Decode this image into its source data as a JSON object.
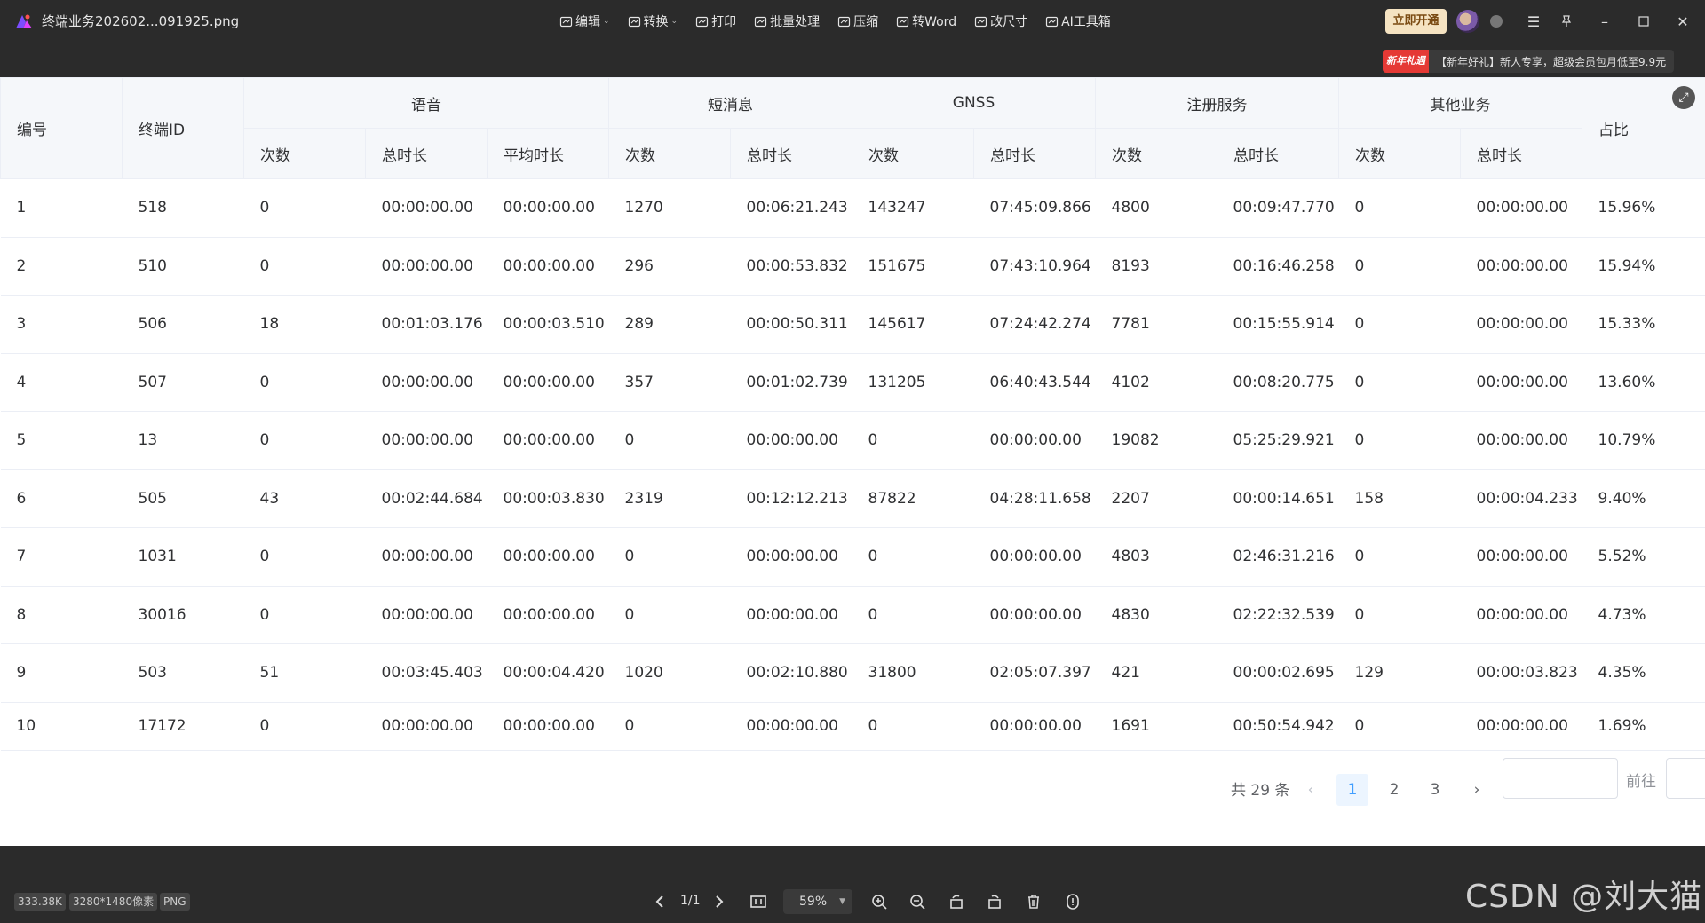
{
  "titlebar": {
    "file_name": "终端业务202602...091925.png",
    "tools": [
      {
        "label": "编辑",
        "icon": "edit-icon",
        "dropdown": true
      },
      {
        "label": "转换",
        "icon": "convert-icon",
        "dropdown": true
      },
      {
        "label": "打印",
        "icon": "print-icon",
        "dropdown": false
      },
      {
        "label": "批量处理",
        "icon": "batch-icon",
        "dropdown": false
      },
      {
        "label": "压缩",
        "icon": "compress-icon",
        "dropdown": false
      },
      {
        "label": "转Word",
        "icon": "word-icon",
        "dropdown": false
      },
      {
        "label": "改尺寸",
        "icon": "resize-icon",
        "dropdown": false
      },
      {
        "label": "AI工具箱",
        "icon": "ai-toolbox-icon",
        "dropdown": false
      }
    ],
    "vip_label": "立即开通",
    "promo_tag": "新年礼遇",
    "promo_text": "【新年好礼】新人专享，超级会员包月低至9.9元"
  },
  "table": {
    "header_groups": {
      "id": "编号",
      "terminal": "终端ID",
      "voice": "语音",
      "sms": "短消息",
      "gnss": "GNSS",
      "register": "注册服务",
      "other": "其他业务",
      "ratio": "占比"
    },
    "sub_headers": {
      "count": "次数",
      "total": "总时长",
      "avg": "平均时长"
    },
    "rows": [
      [
        "1",
        "518",
        "0",
        "00:00:00.00",
        "00:00:00.00",
        "1270",
        "00:06:21.243",
        "143247",
        "07:45:09.866",
        "4800",
        "00:09:47.770",
        "0",
        "00:00:00.00",
        "15.96%"
      ],
      [
        "2",
        "510",
        "0",
        "00:00:00.00",
        "00:00:00.00",
        "296",
        "00:00:53.832",
        "151675",
        "07:43:10.964",
        "8193",
        "00:16:46.258",
        "0",
        "00:00:00.00",
        "15.94%"
      ],
      [
        "3",
        "506",
        "18",
        "00:01:03.176",
        "00:00:03.510",
        "289",
        "00:00:50.311",
        "145617",
        "07:24:42.274",
        "7781",
        "00:15:55.914",
        "0",
        "00:00:00.00",
        "15.33%"
      ],
      [
        "4",
        "507",
        "0",
        "00:00:00.00",
        "00:00:00.00",
        "357",
        "00:01:02.739",
        "131205",
        "06:40:43.544",
        "4102",
        "00:08:20.775",
        "0",
        "00:00:00.00",
        "13.60%"
      ],
      [
        "5",
        "13",
        "0",
        "00:00:00.00",
        "00:00:00.00",
        "0",
        "00:00:00.00",
        "0",
        "00:00:00.00",
        "19082",
        "05:25:29.921",
        "0",
        "00:00:00.00",
        "10.79%"
      ],
      [
        "6",
        "505",
        "43",
        "00:02:44.684",
        "00:00:03.830",
        "2319",
        "00:12:12.213",
        "87822",
        "04:28:11.658",
        "2207",
        "00:00:14.651",
        "158",
        "00:00:04.233",
        "9.40%"
      ],
      [
        "7",
        "1031",
        "0",
        "00:00:00.00",
        "00:00:00.00",
        "0",
        "00:00:00.00",
        "0",
        "00:00:00.00",
        "4803",
        "02:46:31.216",
        "0",
        "00:00:00.00",
        "5.52%"
      ],
      [
        "8",
        "30016",
        "0",
        "00:00:00.00",
        "00:00:00.00",
        "0",
        "00:00:00.00",
        "0",
        "00:00:00.00",
        "4830",
        "02:22:32.539",
        "0",
        "00:00:00.00",
        "4.73%"
      ],
      [
        "9",
        "503",
        "51",
        "00:03:45.403",
        "00:00:04.420",
        "1020",
        "00:02:10.880",
        "31800",
        "02:05:07.397",
        "421",
        "00:00:02.695",
        "129",
        "00:00:03.823",
        "4.35%"
      ],
      [
        "10",
        "17172",
        "0",
        "00:00:00.00",
        "00:00:00.00",
        "0",
        "00:00:00.00",
        "0",
        "00:00:00.00",
        "1691",
        "00:50:54.942",
        "0",
        "00:00:00.00",
        "1.69%"
      ]
    ]
  },
  "pagination": {
    "total_label": "共 29 条",
    "pages": [
      "1",
      "2",
      "3"
    ],
    "current_page": "1",
    "goto_label": "前往"
  },
  "statusbar": {
    "file_size": "333.38K",
    "dimensions": "3280*1480像素",
    "format": "PNG",
    "page_indicator": "1/1",
    "zoom": "59%",
    "watermark": "CSDN @刘大猫."
  }
}
